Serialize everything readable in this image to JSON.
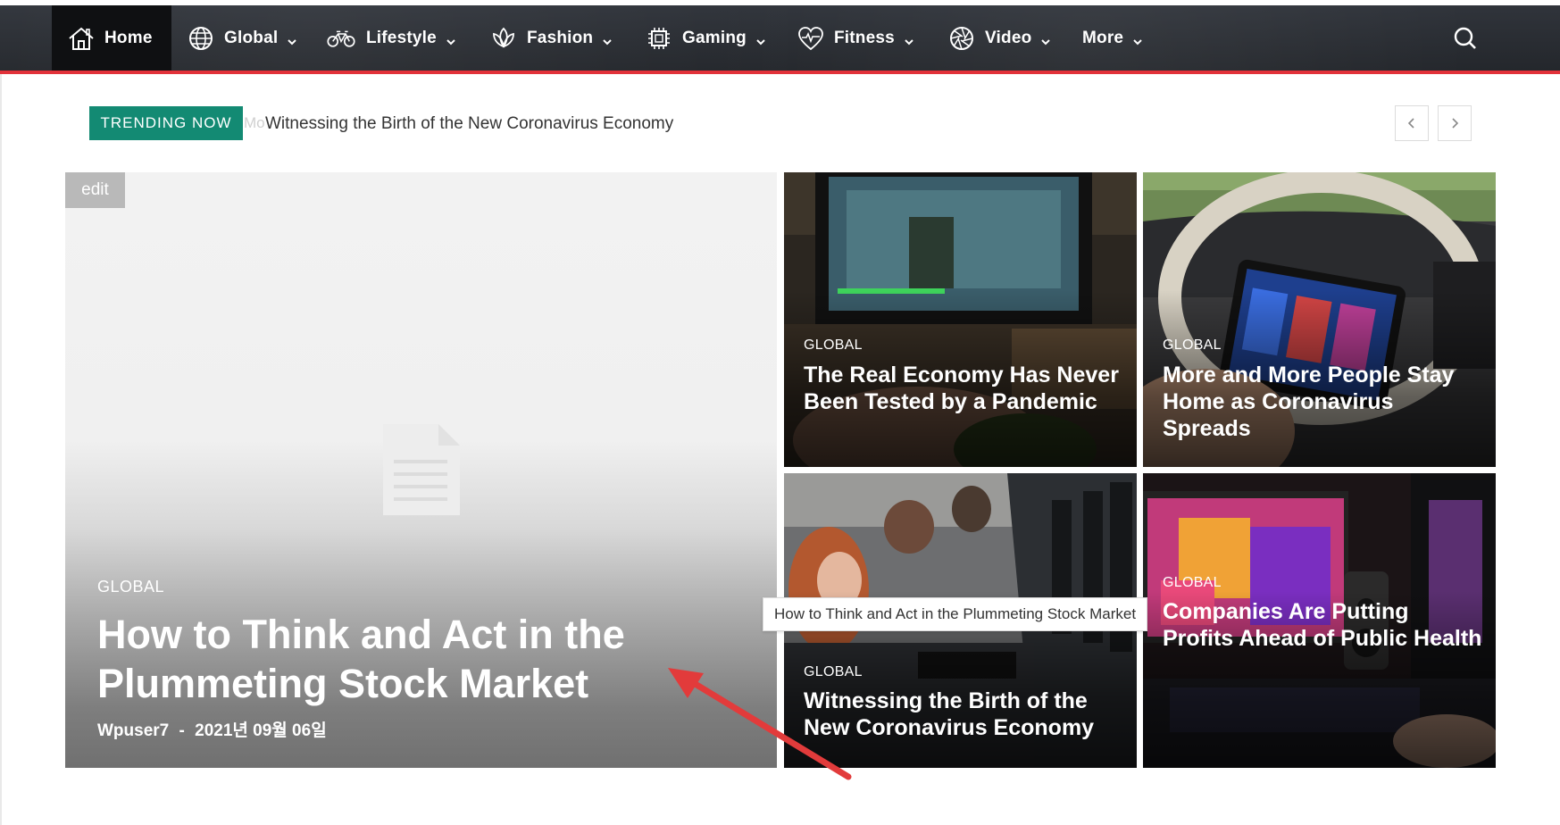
{
  "nav": {
    "items": [
      {
        "label": "Home",
        "icon": "home-icon",
        "dropdown": false
      },
      {
        "label": "Global",
        "icon": "globe-icon",
        "dropdown": true
      },
      {
        "label": "Lifestyle",
        "icon": "bicycle-icon",
        "dropdown": true
      },
      {
        "label": "Fashion",
        "icon": "lotus-icon",
        "dropdown": true
      },
      {
        "label": "Gaming",
        "icon": "chip-icon",
        "dropdown": true
      },
      {
        "label": "Fitness",
        "icon": "heartbeat-icon",
        "dropdown": true
      },
      {
        "label": "Video",
        "icon": "aperture-icon",
        "dropdown": true
      },
      {
        "label": "More",
        "icon": "",
        "dropdown": true
      }
    ],
    "accent_color": "#e2323a",
    "active_bg": "#0f1012"
  },
  "trending": {
    "badge": "TRENDING NOW",
    "ghost": "Mo",
    "headline": "Witnessing the Birth of the New Coronavirus Economy",
    "badge_color": "#138a73"
  },
  "hero": {
    "edit_label": "edit",
    "category": "GLOBAL",
    "title": "How to Think and Act in the Plummeting Stock Market",
    "author": "Wpuser7",
    "separator": "-",
    "date": "2021년 09월 06일"
  },
  "tiles": [
    {
      "category": "GLOBAL",
      "title": "The Real Economy Has Never Been Tested by a Pandemic"
    },
    {
      "category": "GLOBAL",
      "title": "More and More People Stay Home as Coronavirus Spreads"
    },
    {
      "category": "GLOBAL",
      "title": "Witnessing the Birth of the New Coronavirus Economy"
    },
    {
      "category": "GLOBAL",
      "title": "Companies Are Putting Profits Ahead of Public Health"
    }
  ],
  "tooltip": {
    "text": "How to Think and Act in the Plummeting Stock Market"
  },
  "annotation": {
    "arrow_color": "#e23b3b"
  }
}
